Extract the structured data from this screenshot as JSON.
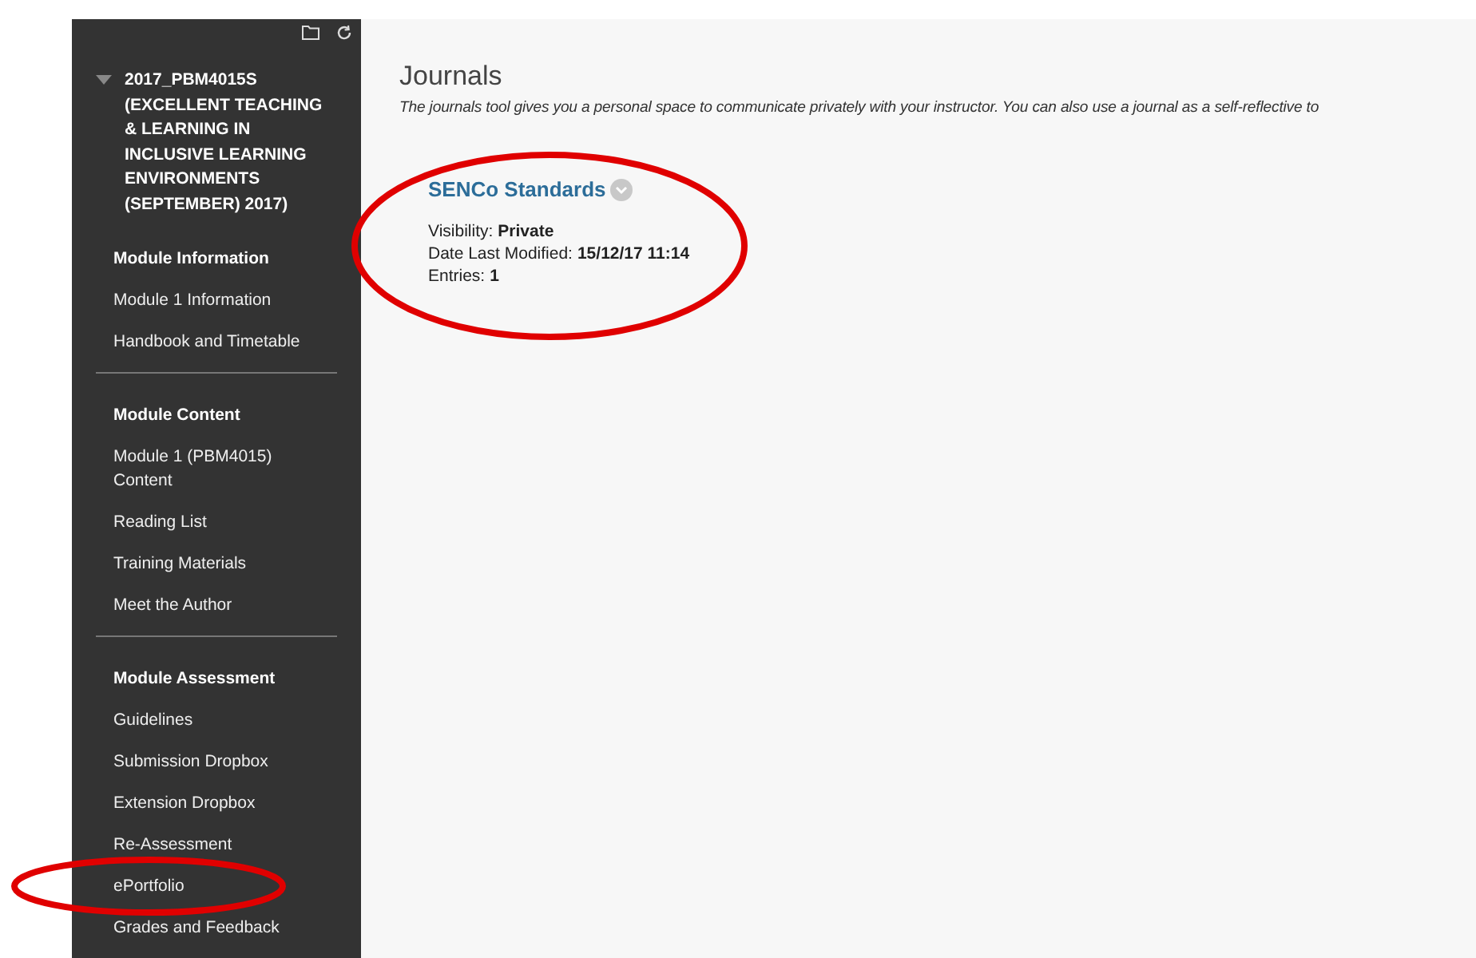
{
  "sidebar": {
    "course_title": "2017_PBM4015S (EXCELLENT TEACHING & LEARNING IN INCLUSIVE LEARNING ENVIRONMENTS (SEPTEMBER) 2017)",
    "expanded": true,
    "sections": [
      {
        "heading": "Module Information",
        "items": [
          "Module 1 Information",
          "Handbook and Timetable"
        ]
      },
      {
        "heading": "Module Content",
        "items": [
          "Module 1 (PBM4015) Content",
          "Reading List",
          "Training Materials",
          "Meet the Author"
        ]
      },
      {
        "heading": "Module Assessment",
        "items": [
          "Guidelines",
          "Submission Dropbox",
          "Extension Dropbox",
          "Re-Assessment",
          "ePortfolio",
          "Grades and Feedback"
        ]
      }
    ]
  },
  "main": {
    "title": "Journals",
    "description": "The journals tool gives you a personal space to communicate privately with your instructor. You can also use a journal as a self-reflective to",
    "journals": [
      {
        "title": "SENCo Standards",
        "fields": [
          {
            "label": "Visibility:",
            "value": "Private"
          },
          {
            "label": "Date Last Modified:",
            "value": "15/12/17 11:14"
          },
          {
            "label": "Entries:",
            "value": "1"
          }
        ]
      }
    ]
  }
}
